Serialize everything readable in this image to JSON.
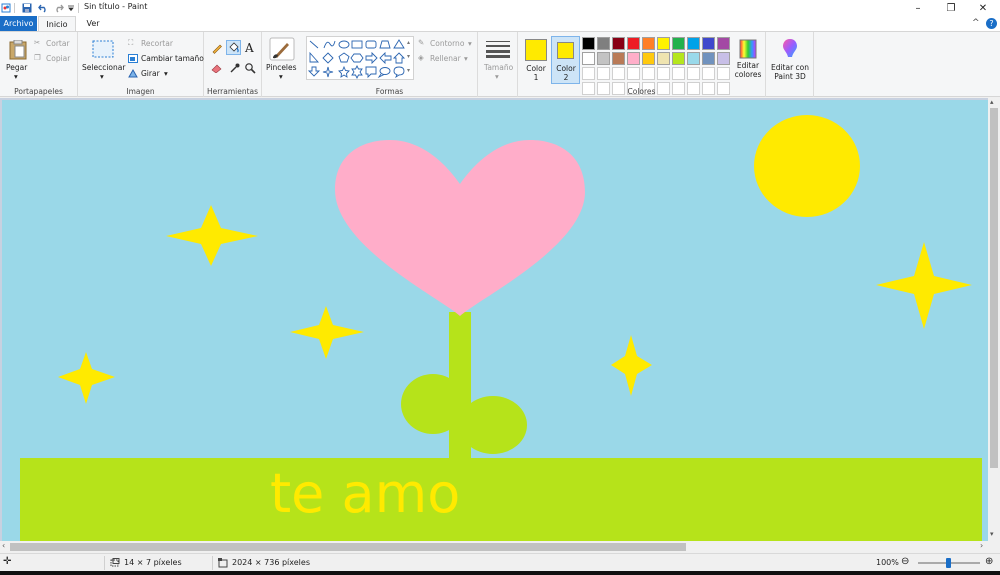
{
  "titlebar": {
    "title": "Sin título - Paint",
    "minimize": "–",
    "restore": "❐",
    "close": "✕"
  },
  "tabs": {
    "file": "Archivo",
    "home": "Inicio",
    "view": "Ver",
    "help": "?",
    "collapse": "^"
  },
  "clipboard": {
    "paste": "Pegar",
    "cut": "Cortar",
    "copy": "Copiar",
    "group_label": "Portapapeles"
  },
  "image": {
    "select": "Seleccionar",
    "crop": "Recortar",
    "resize": "Cambiar tamaño",
    "rotate": "Girar",
    "group_label": "Imagen"
  },
  "tools": {
    "group_label": "Herramientas",
    "text_tool": "A"
  },
  "brushes": {
    "label": "Pinceles"
  },
  "shapes": {
    "outline": "Contorno",
    "fill": "Rellenar",
    "group_label": "Formas"
  },
  "size": {
    "label": "Tamaño"
  },
  "colors": {
    "color1_label": "Color 1",
    "color2_label": "Color 2",
    "color1": "#ffea00",
    "color2": "#ffea00",
    "edit_colors": "Editar colores",
    "edit_paint3d": "Editar con Paint 3D",
    "group_label": "Colores",
    "palette_row1": [
      "#000000",
      "#7f7f7f",
      "#880015",
      "#ed1c24",
      "#ff7f27",
      "#fff200",
      "#22b14c",
      "#00a2e8",
      "#3f48cc",
      "#a349a4"
    ],
    "palette_row2": [
      "#ffffff",
      "#c3c3c3",
      "#b97a57",
      "#ffaec9",
      "#ffc90e",
      "#efe4b0",
      "#b5e61d",
      "#99d9ea",
      "#7092be",
      "#c8bfe7"
    ]
  },
  "drawing": {
    "sky_color": "#9ad8e8",
    "sun_color": "#ffea00",
    "heart_color": "#ffadc9",
    "grass_color": "#b6e31a",
    "text": "te amo",
    "text_color": "#ffea00"
  },
  "status": {
    "selection_size": "14 × 7 píxeles",
    "image_size": "2024 × 736 píxeles",
    "zoom": "100%"
  }
}
